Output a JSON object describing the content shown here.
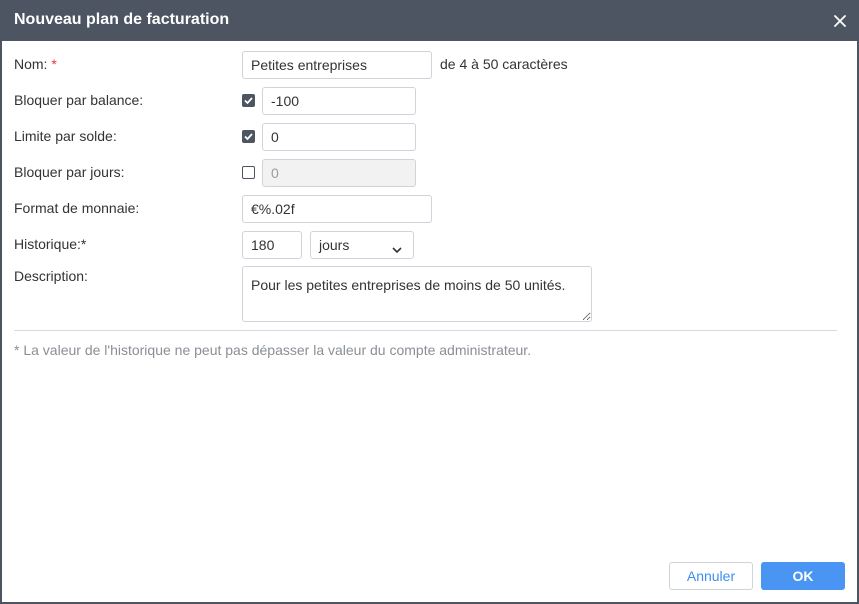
{
  "dialog": {
    "title": "Nouveau plan de facturation"
  },
  "form": {
    "name": {
      "label": "Nom:",
      "required_mark": "*",
      "value": "Petites entreprises",
      "hint": "de 4 à 50 caractères"
    },
    "block_by_balance": {
      "label": "Bloquer par balance:",
      "checked": true,
      "value": "-100"
    },
    "balance_limit": {
      "label": "Limite par solde:",
      "checked": true,
      "value": "0"
    },
    "block_by_days": {
      "label": "Bloquer par jours:",
      "checked": false,
      "value": "0"
    },
    "currency_format": {
      "label": "Format de monnaie:",
      "value": "€%.02f"
    },
    "history": {
      "label": "Historique:*",
      "value": "180",
      "unit": "jours"
    },
    "description": {
      "label": "Description:",
      "value": "Pour les petites entreprises de moins de 50 unités."
    }
  },
  "footnote": "* La valeur de l'historique ne peut pas dépasser la valeur du compte administrateur.",
  "buttons": {
    "cancel": "Annuler",
    "ok": "OK"
  },
  "colors": {
    "titlebar": "#4d5563",
    "primary": "#4a95f3",
    "required": "#e53935"
  }
}
